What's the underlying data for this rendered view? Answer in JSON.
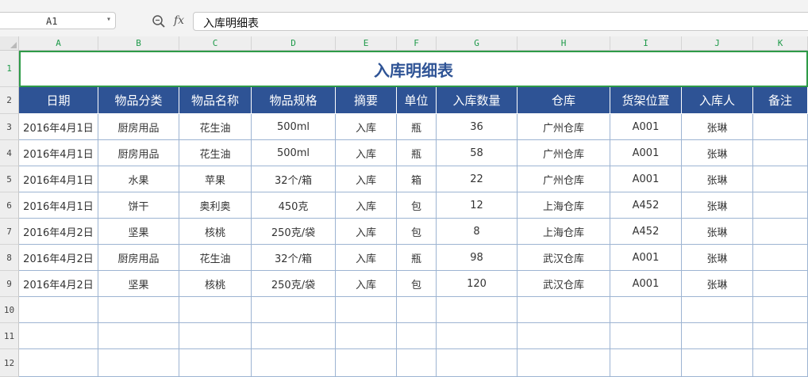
{
  "name_box": {
    "value": "A1"
  },
  "formula_bar": {
    "fx_label": "fx",
    "content": "入库明细表"
  },
  "columns": [
    "A",
    "B",
    "C",
    "D",
    "E",
    "F",
    "G",
    "H",
    "I",
    "J",
    "K"
  ],
  "rows": [
    "1",
    "2",
    "3",
    "4",
    "5",
    "6",
    "7",
    "8",
    "9",
    "10",
    "11",
    "12"
  ],
  "active_cell": "A1",
  "sheet": {
    "title": "入库明细表",
    "headers": [
      "日期",
      "物品分类",
      "物品名称",
      "物品规格",
      "摘要",
      "单位",
      "入库数量",
      "仓库",
      "货架位置",
      "入库人",
      "备注"
    ],
    "data_rows": [
      [
        "2016年4月1日",
        "厨房用品",
        "花生油",
        "500ml",
        "入库",
        "瓶",
        "36",
        "广州仓库",
        "A001",
        "张琳",
        ""
      ],
      [
        "2016年4月1日",
        "厨房用品",
        "花生油",
        "500ml",
        "入库",
        "瓶",
        "58",
        "广州仓库",
        "A001",
        "张琳",
        ""
      ],
      [
        "2016年4月1日",
        "水果",
        "苹果",
        "32个/箱",
        "入库",
        "箱",
        "22",
        "广州仓库",
        "A001",
        "张琳",
        ""
      ],
      [
        "2016年4月1日",
        "饼干",
        "奥利奥",
        "450克",
        "入库",
        "包",
        "12",
        "上海仓库",
        "A452",
        "张琳",
        ""
      ],
      [
        "2016年4月2日",
        "坚果",
        "核桃",
        "250克/袋",
        "入库",
        "包",
        "8",
        "上海仓库",
        "A452",
        "张琳",
        ""
      ],
      [
        "2016年4月2日",
        "厨房用品",
        "花生油",
        "32个/箱",
        "入库",
        "瓶",
        "98",
        "武汉仓库",
        "A001",
        "张琳",
        ""
      ],
      [
        "2016年4月2日",
        "坚果",
        "核桃",
        "250克/袋",
        "入库",
        "包",
        "120",
        "武汉仓库",
        "A001",
        "张琳",
        ""
      ]
    ]
  },
  "colors": {
    "header_fill": "#2e5395",
    "title_text": "#2e5395",
    "selection_border": "#2e9b48",
    "column_label": "#1f9a4a"
  }
}
